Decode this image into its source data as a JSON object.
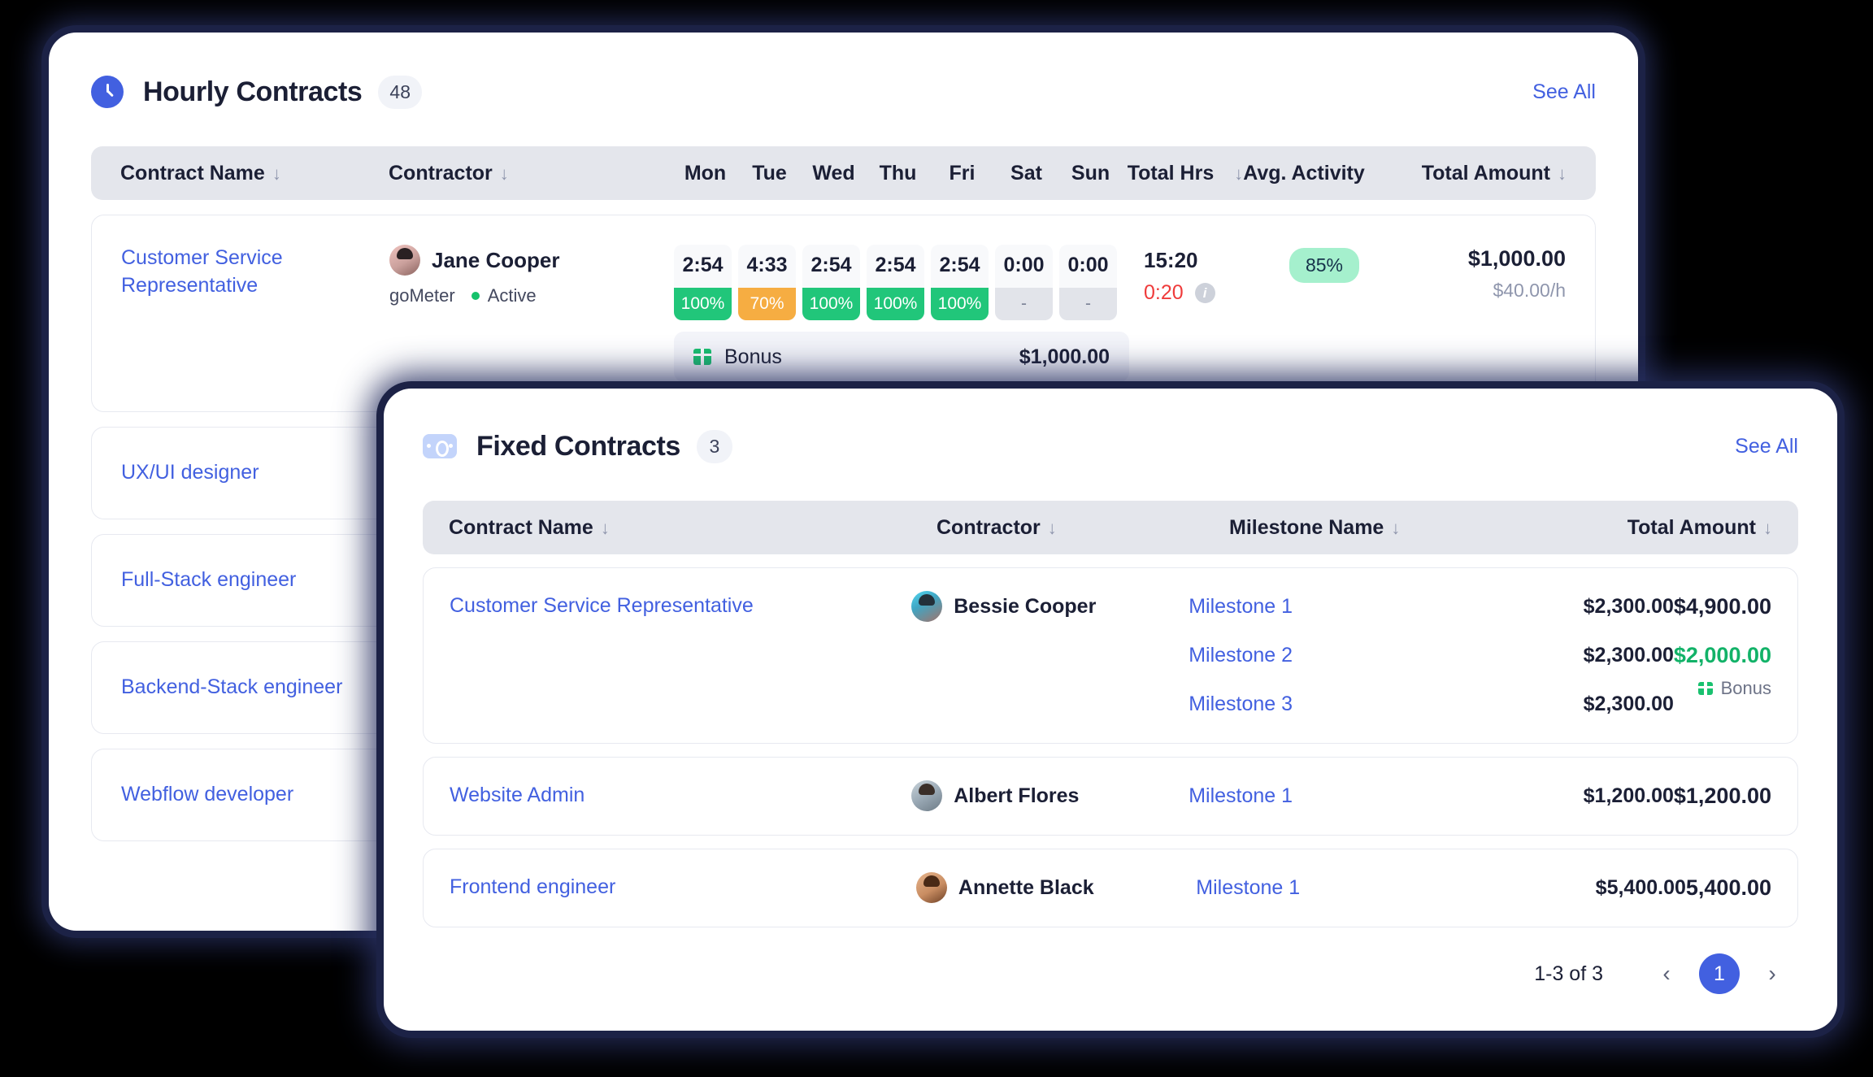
{
  "hourly": {
    "title": "Hourly Contracts",
    "count": "48",
    "icon": "clock-icon",
    "see_all": "See All",
    "columns": {
      "contract_name": "Contract Name",
      "contractor": "Contractor",
      "mon": "Mon",
      "tue": "Tue",
      "wed": "Wed",
      "thu": "Thu",
      "fri": "Fri",
      "sat": "Sat",
      "sun": "Sun",
      "total_hrs": "Total Hrs",
      "avg_activity": "Avg. Activity",
      "total_amount": "Total Amount"
    },
    "row": {
      "contract_name": "Customer Service Representative",
      "contractor_name": "Jane Cooper",
      "contractor_company": "goMeter",
      "contractor_status": "Active",
      "days": [
        {
          "day": "Mon",
          "time": "2:54",
          "pct": "100%"
        },
        {
          "day": "Tue",
          "time": "4:33",
          "pct": "70%"
        },
        {
          "day": "Wed",
          "time": "2:54",
          "pct": "100%"
        },
        {
          "day": "Thu",
          "time": "2:54",
          "pct": "100%"
        },
        {
          "day": "Fri",
          "time": "2:54",
          "pct": "100%"
        },
        {
          "day": "Sat",
          "time": "0:00",
          "pct": "-"
        },
        {
          "day": "Sun",
          "time": "0:00",
          "pct": "-"
        }
      ],
      "bonus_label": "Bonus",
      "bonus_amount": "$1,000.00",
      "total_hrs": "15:20",
      "overtime": "0:20",
      "avg_activity": "85%",
      "total_amount": "$1,000.00",
      "rate": "$40.00/h"
    },
    "other_rows": [
      {
        "contract_name": "UX/UI designer"
      },
      {
        "contract_name": "Full-Stack engineer"
      },
      {
        "contract_name": "Backend-Stack engineer"
      },
      {
        "contract_name": "Webflow developer"
      }
    ]
  },
  "fixed": {
    "title": "Fixed Contracts",
    "count": "3",
    "icon": "money-icon",
    "see_all": "See All",
    "columns": {
      "contract_name": "Contract Name",
      "contractor": "Contractor",
      "milestone_name": "Milestone Name",
      "total_amount": "Total Amount"
    },
    "rows": [
      {
        "contract_name": "Customer Service Representative",
        "contractor": "Bessie Cooper",
        "milestones": [
          {
            "name": "Milestone 1",
            "amount": "$2,300.00"
          },
          {
            "name": "Milestone 2",
            "amount": "$2,300.00"
          },
          {
            "name": "Milestone 3",
            "amount": "$2,300.00"
          }
        ],
        "total_amount": "$4,900.00",
        "bonus_amount": "$2,000.00",
        "bonus_label": "Bonus"
      },
      {
        "contract_name": "Website Admin",
        "contractor": "Albert Flores",
        "milestones": [
          {
            "name": "Milestone 1",
            "amount": "$1,200.00"
          }
        ],
        "total_amount": "$1,200.00"
      },
      {
        "contract_name": "Frontend engineer",
        "contractor": "Annette Black",
        "milestones": [
          {
            "name": "Milestone 1",
            "amount": "$5,400.00"
          }
        ],
        "total_amount": "5,400.00"
      }
    ],
    "pagination": {
      "range": "1-3 of  3",
      "current_page": "1",
      "prev": "‹",
      "next": "›"
    }
  },
  "colors": {
    "accent_blue": "#4260e0",
    "green": "#21c67a",
    "orange": "#f6ad42",
    "red": "#ef3b3b",
    "mint": "#a5f0cd",
    "bonus_green": "#12b268"
  }
}
